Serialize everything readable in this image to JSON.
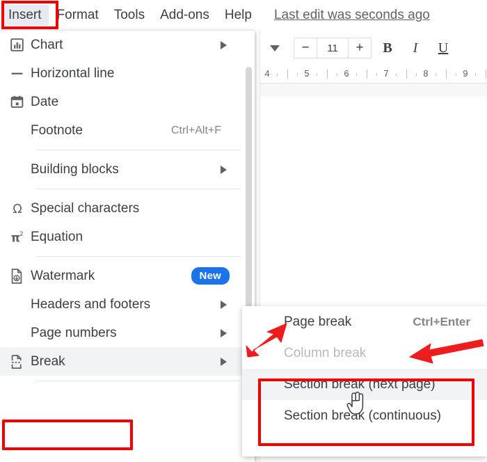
{
  "menubar": {
    "items": [
      {
        "label": "Insert",
        "active": true
      },
      {
        "label": "Format",
        "active": false
      },
      {
        "label": "Tools",
        "active": false
      },
      {
        "label": "Add-ons",
        "active": false
      },
      {
        "label": "Help",
        "active": false
      }
    ],
    "last_edit": "Last edit was seconds ago"
  },
  "toolbar": {
    "caret": "chevron-down",
    "decrease_label": "−",
    "font_size_value": "11",
    "increase_label": "+",
    "bold_label": "B",
    "italic_label": "I",
    "underline_label": "U"
  },
  "ruler": {
    "ticks": [
      "4",
      "5",
      "6",
      "7",
      "8",
      "9"
    ]
  },
  "insert_menu": {
    "items": [
      {
        "label": "Chart",
        "icon": "chart-icon",
        "submenu": true,
        "accel": "",
        "highlight": false
      },
      {
        "label": "Horizontal line",
        "icon": "horizontal-line-icon",
        "submenu": false,
        "accel": "",
        "highlight": false
      },
      {
        "label": "Date",
        "icon": "calendar-icon",
        "submenu": false,
        "accel": "",
        "highlight": false
      },
      {
        "label": "Footnote",
        "icon": "",
        "submenu": false,
        "accel": "Ctrl+Alt+F",
        "highlight": false
      },
      {
        "label": "Building blocks",
        "icon": "",
        "submenu": true,
        "accel": "",
        "highlight": false
      },
      {
        "label": "Special characters",
        "icon": "omega-icon",
        "submenu": false,
        "accel": "",
        "highlight": false
      },
      {
        "label": "Equation",
        "icon": "pi-squared-icon",
        "submenu": false,
        "accel": "",
        "highlight": false
      },
      {
        "label": "Watermark",
        "icon": "watermark-icon",
        "submenu": false,
        "accel": "",
        "badge": "New",
        "highlight": false
      },
      {
        "label": "Headers and footers",
        "icon": "",
        "submenu": true,
        "accel": "",
        "highlight": false
      },
      {
        "label": "Page numbers",
        "icon": "",
        "submenu": true,
        "accel": "",
        "highlight": false
      },
      {
        "label": "Break",
        "icon": "break-icon",
        "submenu": true,
        "accel": "",
        "highlight": true
      }
    ]
  },
  "break_submenu": {
    "items": [
      {
        "label": "Page break",
        "accel": "Ctrl+Enter",
        "disabled": false,
        "highlight": false
      },
      {
        "label": "Column break",
        "accel": "",
        "disabled": true,
        "highlight": false
      },
      {
        "label": "Section break (next page)",
        "accel": "",
        "disabled": false,
        "highlight": true
      },
      {
        "label": "Section break (continuous)",
        "accel": "",
        "disabled": false,
        "highlight": false
      }
    ]
  },
  "annotations": {
    "highlight_color": "#f00000",
    "arrow_color": "#ef1b1b",
    "badge_color": "#1a73e8",
    "boxes": [
      "insert-menu-button",
      "break-menu-item",
      "section-break-options"
    ],
    "arrows": [
      "arrow-pointing-to-page-break",
      "arrow-pointing-to-column-break"
    ],
    "cursor": "hand-pointer"
  }
}
